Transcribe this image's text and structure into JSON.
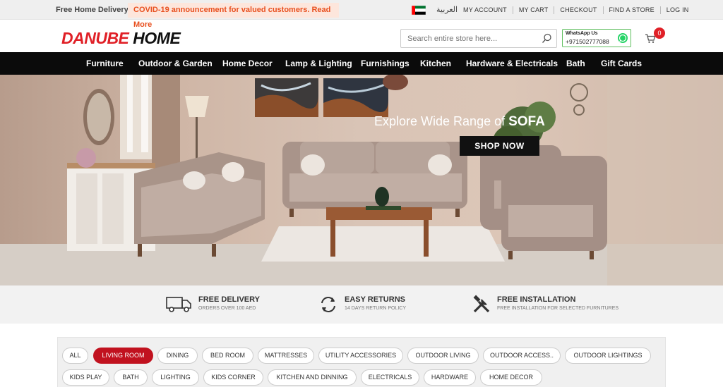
{
  "topbar": {
    "free_delivery": "Free Home Delivery",
    "announcement": "COVID-19 announcement for valued customers. Read More",
    "language": "العربية",
    "links": [
      "MY ACCOUNT",
      "MY CART",
      "CHECKOUT",
      "FIND A STORE",
      "LOG IN"
    ]
  },
  "header": {
    "logo_part1": "DANUBE ",
    "logo_part2": "HOME",
    "search_placeholder": "Search entire store here...",
    "whatsapp_title": "WhatsApp Us",
    "whatsapp_number": "+971502777088",
    "cart_count": "0"
  },
  "nav": {
    "items": [
      "Furniture",
      "Outdoor & Garden",
      "Home Decor",
      "Lamp & Lighting",
      "Furnishings",
      "Kitchen",
      "Hardware & Electricals",
      "Bath",
      "Gift Cards"
    ]
  },
  "hero": {
    "caption_prefix": "Explore Wide Range of ",
    "caption_bold": "SOFA",
    "button": "SHOP NOW"
  },
  "features": [
    {
      "title": "FREE DELIVERY",
      "subtitle": "ORDERS OVER 100 AED",
      "icon": "truck-icon"
    },
    {
      "title": "EASY RETURNS",
      "subtitle": "14 DAYS RETURN POLICY",
      "icon": "returns-icon"
    },
    {
      "title": "FREE INSTALLATION",
      "subtitle": "FREE INSTALLATION FOR SELECTED FURNITURES",
      "icon": "tools-icon"
    }
  ],
  "categories": {
    "row1": [
      "ALL",
      "LIVING ROOM",
      "DINING",
      "BED ROOM",
      "MATTRESSES",
      "UTILITY ACCESSORIES",
      "OUTDOOR LIVING",
      "OUTDOOR ACCESS..",
      "OUTDOOR LIGHTINGS"
    ],
    "row2": [
      "KIDS PLAY",
      "BATH",
      "LIGHTING",
      "KIDS CORNER",
      "KITCHEN AND DINNING",
      "ELECTRICALS",
      "HARDWARE",
      "HOME DECOR"
    ],
    "active": "LIVING ROOM"
  },
  "colors": {
    "brand_red": "#e02027",
    "nav_bg": "#0b0b0b",
    "announcement_text": "#e8501f",
    "whatsapp_green": "#25d366"
  }
}
